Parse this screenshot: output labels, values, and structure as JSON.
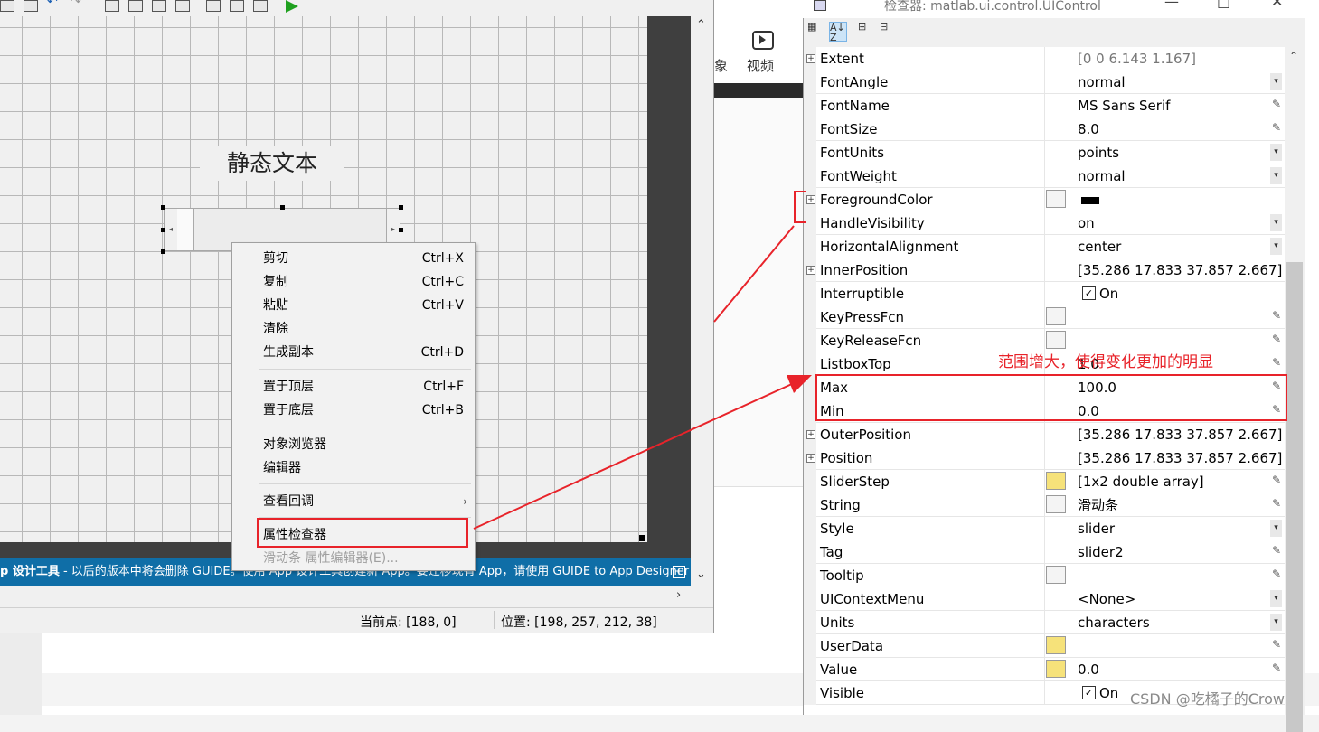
{
  "background": {
    "icon_label": "视频",
    "icon_label_cut": "象"
  },
  "guide": {
    "static_text": "静态文本",
    "banner_prefix": "p 设计工具",
    "banner_text": " - 以后的版本中将会删除 GUIDE。使用 App 设计工具创建新 App。要迁移现有 App，请使用 GUIDE to App Designer Migration...",
    "status": {
      "current_point": "当前点:  [188, 0]",
      "position": "位置: [198, 257, 212, 38]"
    }
  },
  "context_menu": {
    "items": [
      {
        "label": "剪切",
        "shortcut": "Ctrl+X"
      },
      {
        "label": "复制",
        "shortcut": "Ctrl+C"
      },
      {
        "label": "粘贴",
        "shortcut": "Ctrl+V"
      },
      {
        "label": "清除",
        "shortcut": ""
      },
      {
        "label": "生成副本",
        "shortcut": "Ctrl+D"
      },
      {
        "label": "置于顶层",
        "shortcut": "Ctrl+F"
      },
      {
        "label": "置于底层",
        "shortcut": "Ctrl+B"
      },
      {
        "label": "对象浏览器",
        "shortcut": ""
      },
      {
        "label": "编辑器",
        "shortcut": ""
      },
      {
        "label": "查看回调",
        "shortcut": ""
      },
      {
        "label": "属性检查器",
        "shortcut": ""
      },
      {
        "label": "滑动条 属性编辑器(E)...",
        "shortcut": ""
      }
    ]
  },
  "inspector": {
    "title": "检查器:  matlab.ui.control.UIControl",
    "properties": [
      {
        "name": "Extent",
        "value": "[0 0 6.143 1.167]"
      },
      {
        "name": "FontAngle",
        "value": "normal"
      },
      {
        "name": "FontName",
        "value": "MS Sans Serif"
      },
      {
        "name": "FontSize",
        "value": "8.0"
      },
      {
        "name": "FontUnits",
        "value": "points"
      },
      {
        "name": "FontWeight",
        "value": "normal"
      },
      {
        "name": "ForegroundColor",
        "value": ""
      },
      {
        "name": "HandleVisibility",
        "value": "on"
      },
      {
        "name": "HorizontalAlignment",
        "value": "center"
      },
      {
        "name": "InnerPosition",
        "value": "[35.286 17.833 37.857 2.667]"
      },
      {
        "name": "Interruptible",
        "value": "On"
      },
      {
        "name": "KeyPressFcn",
        "value": ""
      },
      {
        "name": "KeyReleaseFcn",
        "value": ""
      },
      {
        "name": "ListboxTop",
        "value": "1.0"
      },
      {
        "name": "Max",
        "value": "100.0"
      },
      {
        "name": "Min",
        "value": "0.0"
      },
      {
        "name": "OuterPosition",
        "value": "[35.286 17.833 37.857 2.667]"
      },
      {
        "name": "Position",
        "value": "[35.286 17.833 37.857 2.667]"
      },
      {
        "name": "SliderStep",
        "value": "[1x2  double array]"
      },
      {
        "name": "String",
        "value": "滑动条"
      },
      {
        "name": "Style",
        "value": "slider"
      },
      {
        "name": "Tag",
        "value": "slider2"
      },
      {
        "name": "Tooltip",
        "value": ""
      },
      {
        "name": "UIContextMenu",
        "value": "<None>"
      },
      {
        "name": "Units",
        "value": "characters"
      },
      {
        "name": "UserData",
        "value": ""
      },
      {
        "name": "Value",
        "value": "0.0"
      },
      {
        "name": "Visible",
        "value": "On"
      }
    ]
  },
  "annotation": {
    "label": "范围增大，使得变化更加的明显",
    "color": "#e8232a"
  },
  "watermark": "CSDN @吃橘子的Crow"
}
